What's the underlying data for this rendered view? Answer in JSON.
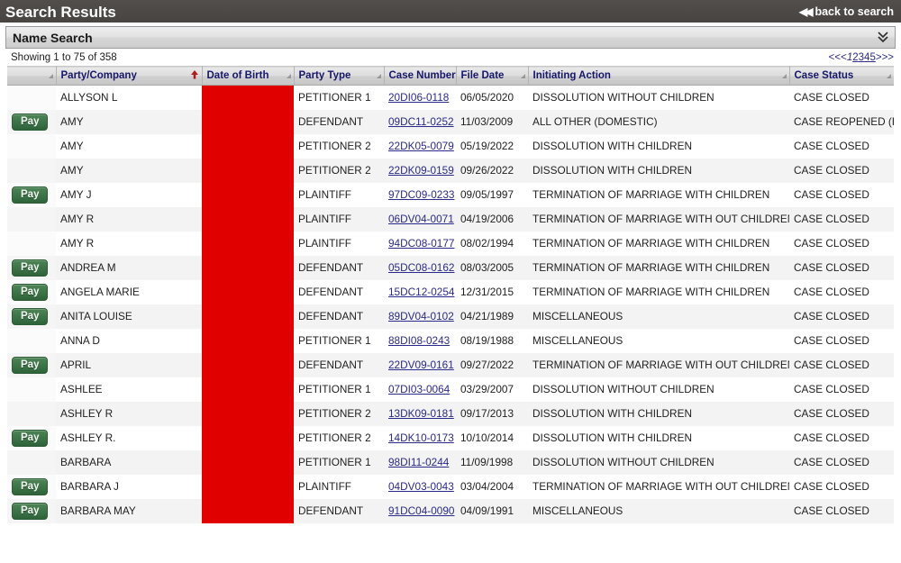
{
  "topbar": {
    "title": "Search Results",
    "back_label": "back to search",
    "back_icon": "double-left-arrow-icon"
  },
  "panel": {
    "title": "Name Search",
    "collapse_icon": "double-chevron-down-icon"
  },
  "summary": {
    "showing_text": "Showing 1 to 75 of 358"
  },
  "pager": {
    "first": "<<",
    "prev": "<",
    "pages": [
      "1",
      "2",
      "3",
      "4",
      "5"
    ],
    "current_page": "1",
    "next": ">",
    "last": ">>"
  },
  "table": {
    "columns": [
      {
        "label": "",
        "key": "pay",
        "sortable": true,
        "state": "none",
        "sort_icon": "sort-triangle-icon"
      },
      {
        "label": "Party/Company",
        "key": "party",
        "sortable": true,
        "state": "active-asc",
        "sort_icon": "sort-asc-red-arrow-icon"
      },
      {
        "label": "Date of Birth",
        "key": "dob",
        "sortable": true,
        "state": "active-secondary",
        "sort_icon": "sort-triangle-icon"
      },
      {
        "label": "Party Type",
        "key": "party_type",
        "sortable": true,
        "state": "none",
        "sort_icon": "sort-triangle-icon"
      },
      {
        "label": "Case Number",
        "key": "case_number",
        "sortable": true,
        "state": "none",
        "sort_icon": "sort-triangle-icon"
      },
      {
        "label": "File Date",
        "key": "file_date",
        "sortable": true,
        "state": "none",
        "sort_icon": "sort-triangle-icon"
      },
      {
        "label": "Initiating Action",
        "key": "initiating_action",
        "sortable": true,
        "state": "none",
        "sort_icon": "sort-triangle-icon"
      },
      {
        "label": "Case Status",
        "key": "case_status",
        "sortable": true,
        "state": "none",
        "sort_icon": "sort-triangle-icon"
      }
    ],
    "pay_label": "Pay",
    "rows": [
      {
        "pay": false,
        "party": "ALLYSON L",
        "party_type": "PETITIONER 1",
        "case_number": "20DI06-0118",
        "file_date": "06/05/2020",
        "initiating_action": "DISSOLUTION WITHOUT CHILDREN",
        "case_status": "CASE CLOSED"
      },
      {
        "pay": true,
        "party": "AMY",
        "party_type": "DEFENDANT",
        "case_number": "09DC11-0252",
        "file_date": "11/03/2009",
        "initiating_action": "ALL OTHER (DOMESTIC)",
        "case_status": "CASE REOPENED (RO)"
      },
      {
        "pay": false,
        "party": "AMY",
        "party_type": "PETITIONER 2",
        "case_number": "22DK05-0079",
        "file_date": "05/19/2022",
        "initiating_action": "DISSOLUTION WITH CHILDREN",
        "case_status": "CASE CLOSED"
      },
      {
        "pay": false,
        "party": "AMY",
        "party_type": "PETITIONER 2",
        "case_number": "22DK09-0159",
        "file_date": "09/26/2022",
        "initiating_action": "DISSOLUTION WITH CHILDREN",
        "case_status": "CASE CLOSED"
      },
      {
        "pay": true,
        "party": "AMY J",
        "party_type": "PLAINTIFF",
        "case_number": "97DC09-0233",
        "file_date": "09/05/1997",
        "initiating_action": "TERMINATION OF MARRIAGE WITH CHILDREN",
        "case_status": "CASE CLOSED"
      },
      {
        "pay": false,
        "party": "AMY R",
        "party_type": "PLAINTIFF",
        "case_number": "06DV04-0071",
        "file_date": "04/19/2006",
        "initiating_action": "TERMINATION OF MARRIAGE WITH OUT CHILDREN",
        "case_status": "CASE CLOSED"
      },
      {
        "pay": false,
        "party": "AMY R",
        "party_type": "PLAINTIFF",
        "case_number": "94DC08-0177",
        "file_date": "08/02/1994",
        "initiating_action": "TERMINATION OF MARRIAGE WITH CHILDREN",
        "case_status": "CASE CLOSED"
      },
      {
        "pay": true,
        "party": "ANDREA M",
        "party_type": "DEFENDANT",
        "case_number": "05DC08-0162",
        "file_date": "08/03/2005",
        "initiating_action": "TERMINATION OF MARRIAGE WITH CHILDREN",
        "case_status": "CASE CLOSED"
      },
      {
        "pay": true,
        "party": "ANGELA MARIE",
        "party_type": "DEFENDANT",
        "case_number": "15DC12-0254",
        "file_date": "12/31/2015",
        "initiating_action": "TERMINATION OF MARRIAGE WITH CHILDREN",
        "case_status": "CASE CLOSED"
      },
      {
        "pay": true,
        "party": "ANITA LOUISE",
        "party_type": "DEFENDANT",
        "case_number": "89DV04-0102",
        "file_date": "04/21/1989",
        "initiating_action": "MISCELLANEOUS",
        "case_status": "CASE CLOSED"
      },
      {
        "pay": false,
        "party": "ANNA D",
        "party_type": "PETITIONER 1",
        "case_number": "88DI08-0243",
        "file_date": "08/19/1988",
        "initiating_action": "MISCELLANEOUS",
        "case_status": "CASE CLOSED"
      },
      {
        "pay": true,
        "party": "APRIL",
        "party_type": "DEFENDANT",
        "case_number": "22DV09-0161",
        "file_date": "09/27/2022",
        "initiating_action": "TERMINATION OF MARRIAGE WITH OUT CHILDREN",
        "case_status": "CASE CLOSED"
      },
      {
        "pay": false,
        "party": "ASHLEE",
        "party_type": "PETITIONER 1",
        "case_number": "07DI03-0064",
        "file_date": "03/29/2007",
        "initiating_action": "DISSOLUTION WITHOUT CHILDREN",
        "case_status": "CASE CLOSED"
      },
      {
        "pay": false,
        "party": "ASHLEY R",
        "party_type": "PETITIONER 2",
        "case_number": "13DK09-0181",
        "file_date": "09/17/2013",
        "initiating_action": "DISSOLUTION WITH CHILDREN",
        "case_status": "CASE CLOSED"
      },
      {
        "pay": true,
        "party": "ASHLEY R.",
        "party_type": "PETITIONER 2",
        "case_number": "14DK10-0173",
        "file_date": "10/10/2014",
        "initiating_action": "DISSOLUTION WITH CHILDREN",
        "case_status": "CASE CLOSED"
      },
      {
        "pay": false,
        "party": "BARBARA",
        "party_type": "PETITIONER 1",
        "case_number": "98DI11-0244",
        "file_date": "11/09/1998",
        "initiating_action": "DISSOLUTION WITHOUT CHILDREN",
        "case_status": "CASE CLOSED"
      },
      {
        "pay": true,
        "party": "BARBARA J",
        "party_type": "PLAINTIFF",
        "case_number": "04DV03-0043",
        "file_date": "03/04/2004",
        "initiating_action": "TERMINATION OF MARRIAGE WITH OUT CHILDREN",
        "case_status": "CASE CLOSED"
      },
      {
        "pay": true,
        "party": "BARBARA MAY",
        "party_type": "DEFENDANT",
        "case_number": "91DC04-0090",
        "file_date": "04/09/1991",
        "initiating_action": "MISCELLANEOUS",
        "case_status": "CASE CLOSED"
      }
    ]
  },
  "colors": {
    "topbar_bg": "#4d4a47",
    "redaction": "#e00000",
    "link": "#2a2a8a",
    "header_text": "#16166b",
    "pay_button": "#3b7346",
    "sort_arrow": "#b01c1c"
  }
}
